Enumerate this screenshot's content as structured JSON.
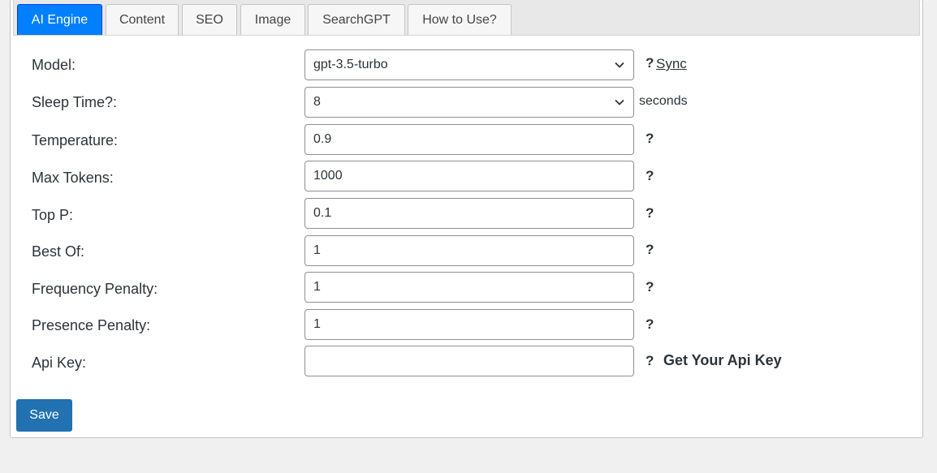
{
  "tabs": [
    {
      "label": "AI Engine"
    },
    {
      "label": "Content"
    },
    {
      "label": "SEO"
    },
    {
      "label": "Image"
    },
    {
      "label": "SearchGPT"
    },
    {
      "label": "How to Use?"
    }
  ],
  "form": {
    "model": {
      "label": "Model:",
      "value": "gpt-3.5-turbo",
      "help": "?",
      "sync": "Sync"
    },
    "sleep_time": {
      "label": "Sleep Time?:",
      "value": "8",
      "unit": "seconds"
    },
    "temperature": {
      "label": "Temperature:",
      "value": "0.9",
      "help": "?"
    },
    "max_tokens": {
      "label": "Max Tokens:",
      "value": "1000",
      "help": "?"
    },
    "top_p": {
      "label": "Top P:",
      "value": "0.1",
      "help": "?"
    },
    "best_of": {
      "label": "Best Of:",
      "value": "1",
      "help": "?"
    },
    "frequency_penalty": {
      "label": "Frequency Penalty:",
      "value": "1",
      "help": "?"
    },
    "presence_penalty": {
      "label": "Presence Penalty:",
      "value": "1",
      "help": "?"
    },
    "api_key": {
      "label": "Api Key:",
      "value": "",
      "help": "?",
      "link": "Get Your Api Key"
    }
  },
  "save_label": "Save",
  "colors": {
    "active_tab": "#007fff",
    "save_button": "#2271b1"
  }
}
